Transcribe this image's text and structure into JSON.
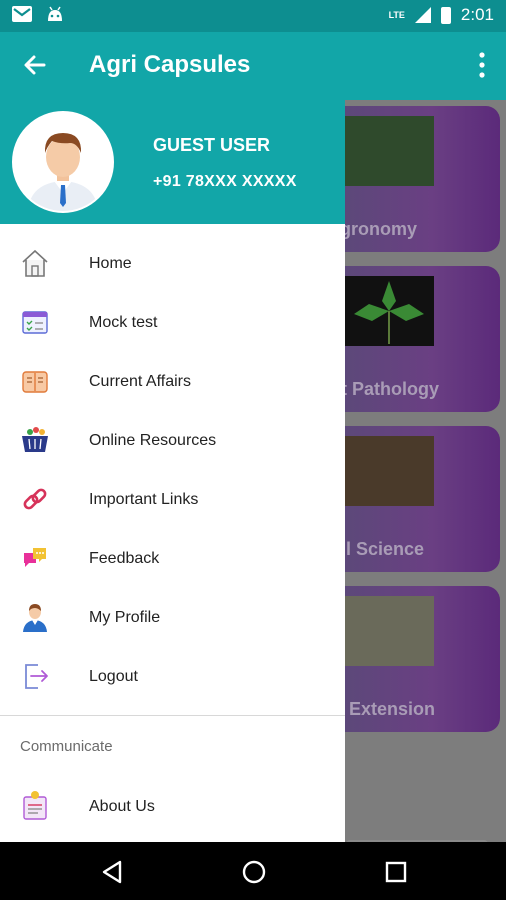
{
  "status_bar": {
    "time": "2:01",
    "network": "LTE"
  },
  "app_bar": {
    "title": "Agri Capsules"
  },
  "user": {
    "name": "GUEST USER",
    "phone": "+91 78XXX XXXXX"
  },
  "menu": [
    {
      "label": "Home",
      "icon": "home-icon"
    },
    {
      "label": "Mock test",
      "icon": "mock-test-icon"
    },
    {
      "label": "Current Affairs",
      "icon": "current-affairs-icon"
    },
    {
      "label": "Online Resources",
      "icon": "online-resources-icon"
    },
    {
      "label": "Important Links",
      "icon": "link-icon"
    },
    {
      "label": "Feedback",
      "icon": "feedback-icon"
    },
    {
      "label": "My Profile",
      "icon": "profile-icon"
    },
    {
      "label": "Logout",
      "icon": "logout-icon"
    }
  ],
  "communicate": {
    "title": "Communicate",
    "about_label": "About Us"
  },
  "background_cards": [
    {
      "label": "gronomy"
    },
    {
      "label": "nt Pathology"
    },
    {
      "label": "oil Science"
    },
    {
      "label": "l. Extension"
    }
  ],
  "colors": {
    "primary": "#12a6a8",
    "status_bar": "#0d8e90",
    "card_purple": "#6a3f83"
  }
}
